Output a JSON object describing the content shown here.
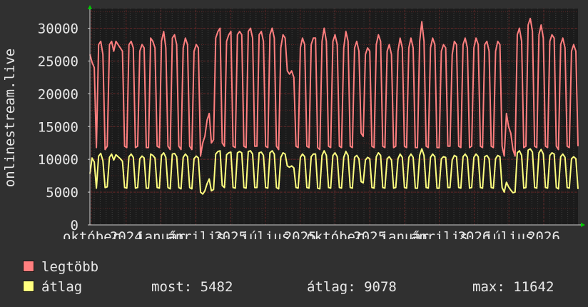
{
  "chart_data": {
    "type": "line",
    "ylabel": "onlinestream.live",
    "ylim": [
      0,
      33000
    ],
    "yticks": [
      0,
      5000,
      10000,
      15000,
      20000,
      25000,
      30000
    ],
    "x_tick_labels": [
      "október",
      "2024",
      "január",
      "április",
      "2025",
      "július",
      "2025",
      "október",
      "2025",
      "január",
      "április",
      "2026",
      "július",
      "2026"
    ],
    "grid": true,
    "n_points": 224,
    "series": [
      {
        "name": "legtöbb",
        "color": "#ff7f7f",
        "values": [
          26000,
          24800,
          24000,
          11800,
          27500,
          28000,
          26000,
          11500,
          12000,
          27500,
          28000,
          26500,
          28000,
          27500,
          27000,
          26500,
          12000,
          11800,
          27500,
          28000,
          27000,
          11800,
          12000,
          26500,
          27500,
          27000,
          11800,
          11800,
          28500,
          28000,
          27000,
          12000,
          11800,
          28000,
          29500,
          27000,
          12000,
          11500,
          28500,
          29000,
          27500,
          12000,
          11500,
          27000,
          28500,
          27500,
          12000,
          11500,
          26500,
          27500,
          27000,
          10500,
          12500,
          13500,
          16000,
          17000,
          12500,
          13000,
          28500,
          29500,
          30000,
          12500,
          12000,
          28000,
          29000,
          29500,
          12000,
          11800,
          29000,
          29500,
          29000,
          12000,
          11800,
          29500,
          30000,
          28500,
          12000,
          12000,
          29000,
          29500,
          28000,
          12000,
          11800,
          29000,
          30000,
          28500,
          12000,
          11500,
          27000,
          29000,
          28500,
          23500,
          23000,
          23500,
          22500,
          12000,
          11800,
          27000,
          28500,
          27500,
          12000,
          11800,
          27500,
          28500,
          28500,
          11800,
          11500,
          28000,
          30000,
          28000,
          12000,
          11800,
          28000,
          29000,
          27500,
          12000,
          11800,
          27000,
          29500,
          28000,
          12000,
          11800,
          27000,
          28000,
          26500,
          14000,
          13500,
          26000,
          27000,
          26500,
          12000,
          11800,
          27500,
          29000,
          28000,
          12000,
          11800,
          26500,
          27500,
          26000,
          11800,
          12000,
          26500,
          28500,
          27000,
          12000,
          11800,
          27000,
          28500,
          27000,
          11800,
          11800,
          28000,
          31000,
          28000,
          12000,
          11800,
          27000,
          28500,
          27500,
          11800,
          11800,
          26500,
          27500,
          27000,
          12000,
          12000,
          26000,
          28000,
          27500,
          12000,
          11800,
          27500,
          28500,
          27000,
          11800,
          12000,
          27000,
          28500,
          27500,
          12000,
          11800,
          27500,
          28000,
          26500,
          12000,
          11800,
          26500,
          28000,
          27500,
          12000,
          10500,
          17000,
          15000,
          14000,
          11500,
          10500,
          29000,
          30000,
          28000,
          11800,
          12000,
          30500,
          31500,
          29500,
          12000,
          11800,
          29000,
          30500,
          28500,
          12000,
          11800,
          28000,
          29000,
          28500,
          12000,
          11500,
          27500,
          28500,
          27000,
          12000,
          11800,
          26500,
          27500,
          26500,
          12000
        ],
        "note_last": 12000
      },
      {
        "name": "átlag",
        "color": "#ffff7f",
        "values": [
          7800,
          10200,
          9600,
          5600,
          10500,
          10900,
          9800,
          5700,
          5800,
          10300,
          10800,
          9900,
          10700,
          10400,
          10100,
          9700,
          5700,
          5600,
          10400,
          10800,
          10300,
          5600,
          5700,
          10100,
          10500,
          10200,
          5600,
          5600,
          10800,
          10600,
          10200,
          5700,
          5600,
          10600,
          11000,
          10300,
          5700,
          5500,
          10800,
          10900,
          10400,
          5700,
          5500,
          10300,
          10800,
          10400,
          5700,
          5500,
          10100,
          10500,
          10200,
          5000,
          4700,
          5200,
          6300,
          7000,
          5200,
          5400,
          10800,
          11200,
          11300,
          6000,
          5700,
          10700,
          11000,
          11100,
          5700,
          5600,
          11000,
          11200,
          11000,
          5700,
          5600,
          11200,
          11300,
          10800,
          5700,
          5700,
          11000,
          11100,
          10600,
          5700,
          5600,
          11000,
          11300,
          10800,
          5700,
          5500,
          10300,
          11000,
          10800,
          9000,
          8800,
          9000,
          8700,
          5700,
          5600,
          10300,
          10800,
          10400,
          5700,
          5600,
          10400,
          10800,
          10800,
          5600,
          5500,
          10600,
          11300,
          10600,
          5700,
          5600,
          10600,
          11000,
          10400,
          5700,
          5600,
          10300,
          11200,
          10600,
          5700,
          5600,
          10300,
          10600,
          10100,
          6600,
          6400,
          9900,
          10300,
          10100,
          5700,
          5600,
          10400,
          11000,
          10600,
          5700,
          5600,
          10100,
          10400,
          9900,
          5600,
          5700,
          10100,
          10800,
          10300,
          5700,
          5600,
          10300,
          10800,
          10300,
          5600,
          5600,
          10600,
          11600,
          10600,
          5700,
          5600,
          10300,
          10800,
          10400,
          5600,
          5600,
          10100,
          10400,
          10300,
          5700,
          5700,
          9900,
          10600,
          10400,
          5700,
          5600,
          10400,
          10800,
          10300,
          5600,
          5700,
          10300,
          10800,
          10400,
          5700,
          5600,
          10400,
          10600,
          10100,
          5700,
          5600,
          10100,
          10600,
          10400,
          5700,
          5000,
          6500,
          5800,
          5300,
          4900,
          5000,
          11000,
          11300,
          10600,
          5600,
          5700,
          11400,
          11600,
          11100,
          5700,
          5600,
          11000,
          11500,
          10800,
          5700,
          5600,
          10600,
          11000,
          10800,
          5700,
          5500,
          10400,
          10800,
          10300,
          5700,
          5600,
          10100,
          10400,
          10100,
          5482
        ]
      }
    ]
  },
  "legend": [
    {
      "label": "legtöbb",
      "color": "#ff7f7f"
    },
    {
      "label": "átlag",
      "color": "#ffff7f"
    }
  ],
  "stats": {
    "now": "most: 5482",
    "avg": "átlag: 9078",
    "max": "max: 11642"
  }
}
